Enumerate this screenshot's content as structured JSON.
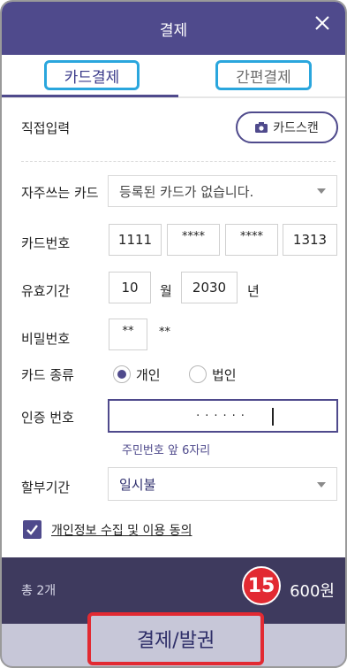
{
  "header": {
    "title": "결제"
  },
  "tabs": {
    "card": "카드결제",
    "simple": "간편결제"
  },
  "direct_input": {
    "label": "직접입력",
    "scan_label": "카드스캔"
  },
  "favorite_card": {
    "label": "자주쓰는 카드",
    "value": "등록된 카드가 없습니다."
  },
  "card_number": {
    "label": "카드번호",
    "part1": "1111",
    "part2": "****",
    "part3": "****",
    "part4": "1313"
  },
  "expiry": {
    "label": "유효기간",
    "month": "10",
    "month_unit": "월",
    "year": "2030",
    "year_unit": "년"
  },
  "password": {
    "label": "비밀번호",
    "input": "**",
    "masked_suffix": "**"
  },
  "card_type": {
    "label": "카드 종류",
    "personal": "개인",
    "corporate": "법인",
    "selected": "개인"
  },
  "auth_number": {
    "label": "인증 번호",
    "value": "······",
    "hint": "주민번호 앞 6자리"
  },
  "installment": {
    "label": "할부기간",
    "value": "일시불"
  },
  "agreement": {
    "label": "개인정보 수집 및 이용 동의",
    "checked": true
  },
  "footer": {
    "count": "총 2개",
    "total_visible": "600원",
    "pay_button": "결제/발권"
  },
  "annotation": {
    "number": "15"
  },
  "colors": {
    "primary": "#4f4a8c",
    "highlight": "#2aa6dd",
    "accent_red": "#e22a32"
  }
}
